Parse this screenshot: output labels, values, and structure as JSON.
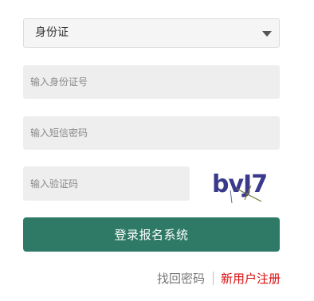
{
  "form": {
    "id_type_select": {
      "selected": "身份证"
    },
    "id_number": {
      "placeholder": "输入身份证号",
      "value": ""
    },
    "sms_code": {
      "placeholder": "输入短信密码",
      "value": ""
    },
    "captcha": {
      "placeholder": "输入验证码",
      "value": "",
      "image_text": "bvJ7"
    },
    "login_button_label": "登录报名系统"
  },
  "links": {
    "forgot_password": "找回密码",
    "register": "新用户注册"
  },
  "colors": {
    "primary_button": "#2f7a66",
    "register_link": "#d80c0c",
    "input_background": "#eeeeee",
    "captcha_text": "#3a3a8c"
  },
  "icons": {
    "select_arrow": "chevron-down-icon"
  }
}
